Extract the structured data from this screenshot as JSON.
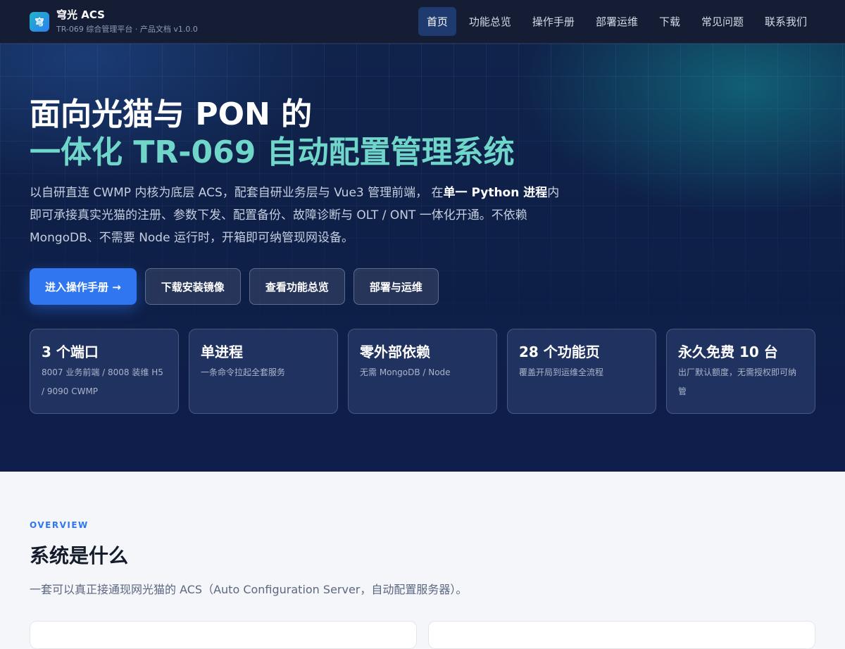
{
  "nav": {
    "logo_char": "穹",
    "brand": "穹光 ACS",
    "subtitle": "TR-069 综合管理平台 · 产品文档 v1.0.0",
    "links": [
      "首页",
      "功能总览",
      "操作手册",
      "部署运维",
      "下载",
      "常见问题",
      "联系我们"
    ]
  },
  "hero": {
    "title_line1": "面向光猫与 PON 的",
    "title_line2": "一体化 TR-069 自动配置管理系统",
    "lead_part1": "以自研直连 CWMP 内核为底层 ACS，配套自研业务层与 Vue3 管理前端， 在",
    "lead_bold": "单一 Python 进程",
    "lead_part2": "内即可承接真实光猫的注册、参数下发、配置备份、故障诊断与 OLT / ONT 一体化开通。不依赖 MongoDB、不需要 Node 运行时，开箱即可纳管现网设备。",
    "buttons": [
      "进入操作手册 →",
      "下载安装镜像",
      "查看功能总览",
      "部署与运维"
    ],
    "stats": [
      {
        "title": "3 个端口",
        "desc": "8007 业务前端 / 8008 装维 H5 / 9090 CWMP"
      },
      {
        "title": "单进程",
        "desc": "一条命令拉起全套服务"
      },
      {
        "title": "零外部依赖",
        "desc": "无需 MongoDB / Node"
      },
      {
        "title": "28 个功能页",
        "desc": "覆盖开局到运维全流程"
      },
      {
        "title": "永久免费 10 台",
        "desc": "出厂默认额度，无需授权即可纳管"
      }
    ]
  },
  "overview": {
    "eyebrow": "OVERVIEW",
    "title": "系统是什么",
    "desc": "一套可以真正接通现网光猫的 ACS（Auto Configuration Server，自动配置服务器）。"
  },
  "colors": {
    "accent": "#2f76f0",
    "teal": "#6fd6c9",
    "nav_bg": "#141d33",
    "hero_bg": "#0e1f47"
  }
}
